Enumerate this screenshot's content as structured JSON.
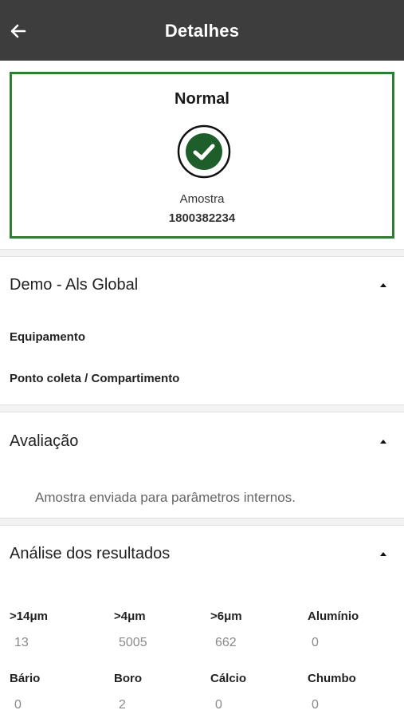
{
  "header": {
    "title": "Detalhes",
    "back_icon": "arrow-left-icon"
  },
  "status_card": {
    "title": "Normal",
    "icon": "check-circle-icon",
    "status_color": "#1e5e2b",
    "border_color": "#2e7d32",
    "sample_label": "Amostra",
    "sample_number": "1800382234"
  },
  "sections": {
    "company": {
      "title": "Demo - Als Global",
      "fields": [
        "Equipamento",
        "Ponto coleta / Compartimento"
      ]
    },
    "evaluation": {
      "title": "Avaliação",
      "text": "Amostra enviada para parâmetros internos."
    },
    "results": {
      "title": "Análise dos resultados",
      "row1": [
        {
          "label": ">14μm",
          "value": "13"
        },
        {
          "label": ">4μm",
          "value": "5005"
        },
        {
          "label": ">6μm",
          "value": "662"
        },
        {
          "label": "Alumínio",
          "value": "0"
        }
      ],
      "row2": [
        {
          "label": "Bário",
          "value": "0"
        },
        {
          "label": "Boro",
          "value": "2"
        },
        {
          "label": "Cálcio",
          "value": "0"
        },
        {
          "label": "Chumbo",
          "value": "0"
        }
      ]
    }
  }
}
